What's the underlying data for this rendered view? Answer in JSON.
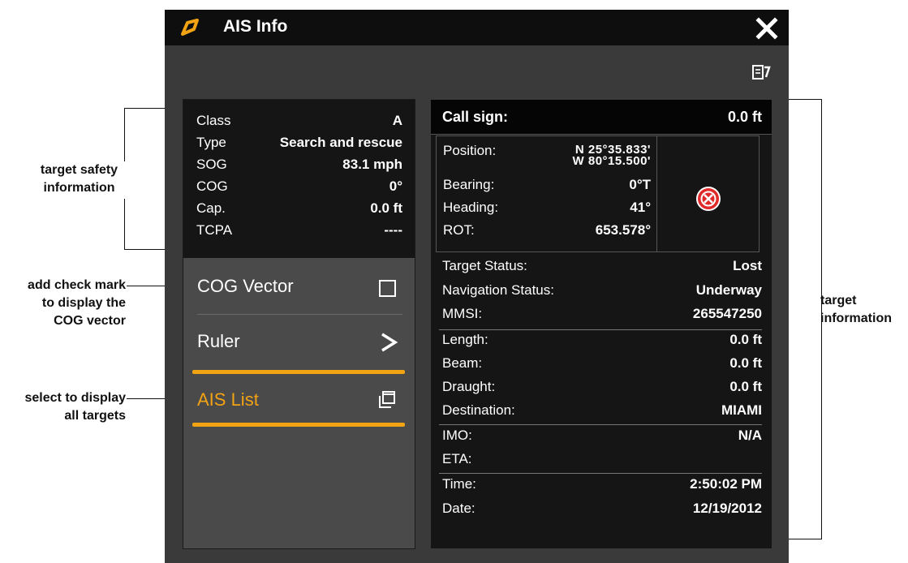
{
  "window": {
    "title": "AIS Info",
    "close_label": "X",
    "accent_color": "#f2a313"
  },
  "callouts": {
    "safety": "target safety\ninformation",
    "check": "add check mark\nto display the\nCOG vector",
    "list": "select to display\nall targets",
    "target": "target\ninformation"
  },
  "safety": {
    "rows": [
      {
        "label": "Class",
        "value": "A"
      },
      {
        "label": "Type",
        "value": "Search and rescue"
      },
      {
        "label": "SOG",
        "value": "83.1 mph"
      },
      {
        "label": "COG",
        "value": "0°"
      },
      {
        "label": "Cap.",
        "value": "0.0 ft"
      },
      {
        "label": "TCPA",
        "value": "----"
      }
    ]
  },
  "menu": {
    "cog_vector": "COG Vector",
    "ruler": "Ruler",
    "ais_list": "AIS List",
    "cog_checked": false
  },
  "target": {
    "call_sign_label": "Call sign:",
    "call_sign_value": "0.0 ft",
    "position_label": "Position:",
    "position_lat": "N 25°35.833'",
    "position_lon": "W 80°15.500'",
    "bearing_label": "Bearing:",
    "bearing_value": "0°T",
    "heading_label": "Heading:",
    "heading_value": "41°",
    "rot_label": "ROT:",
    "rot_value": "653.578°",
    "rows": [
      {
        "label": "Target Status:",
        "value": "Lost"
      },
      {
        "label": "Navigation Status:",
        "value": "Underway"
      },
      {
        "label": "MMSI:",
        "value": "265547250"
      },
      {
        "label": "Length:",
        "value": "0.0 ft"
      },
      {
        "label": "Beam:",
        "value": "0.0 ft"
      },
      {
        "label": "Draught:",
        "value": "0.0 ft"
      },
      {
        "label": "Destination:",
        "value": "MIAMI"
      },
      {
        "label": "IMO:",
        "value": "N/A"
      },
      {
        "label": "ETA:",
        "value": ""
      },
      {
        "label": "Time:",
        "value": "2:50:02 PM"
      },
      {
        "label": "Date:",
        "value": "12/19/2012"
      }
    ]
  },
  "icons": {
    "title": "ais-target-icon",
    "close": "close-icon",
    "toolbar": "list-page-icon",
    "ruler": "chevron-right-icon",
    "ais_list": "stacked-windows-icon",
    "target_status": "lost-target-icon"
  }
}
